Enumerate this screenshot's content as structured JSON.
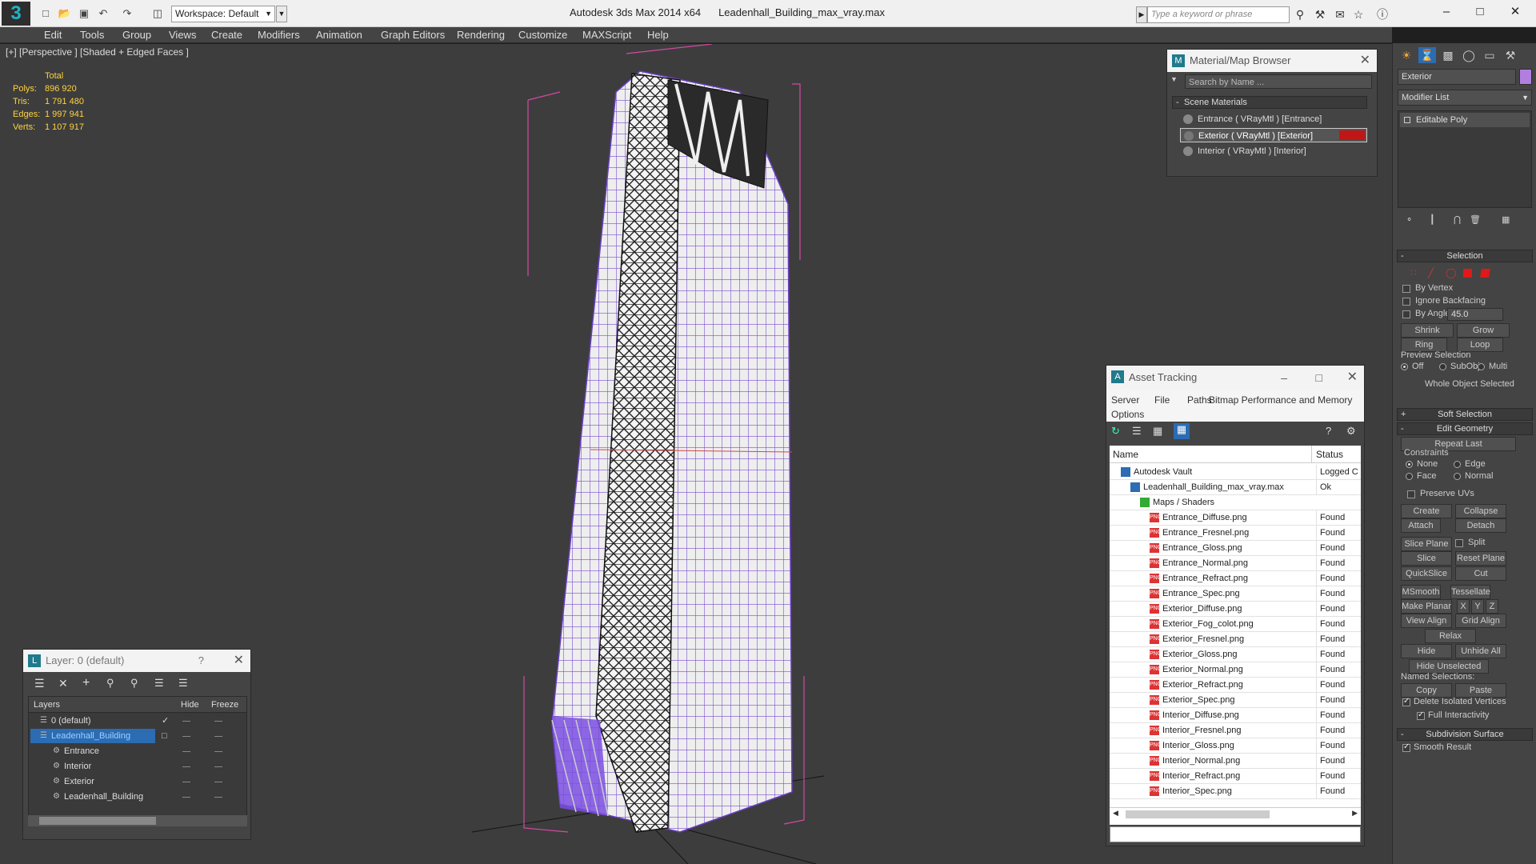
{
  "app": {
    "logo": "3",
    "workspace": "Workspace: Default",
    "title_app": "Autodesk 3ds Max  2014 x64",
    "title_file": "Leadenhall_Building_max_vray.max",
    "search_placeholder": "Type a keyword or phrase"
  },
  "menu": [
    "Edit",
    "Tools",
    "Group",
    "Views",
    "Create",
    "Modifiers",
    "Animation",
    "Graph Editors",
    "Rendering",
    "Customize",
    "MAXScript",
    "Help"
  ],
  "viewport": {
    "label": "[+] [Perspective ] [Shaded + Edged Faces ]",
    "stats": {
      "header": "Total",
      "rows": [
        {
          "k": "Polys:",
          "v": "896 920"
        },
        {
          "k": "Tris:",
          "v": "1 791 480"
        },
        {
          "k": "Edges:",
          "v": "1 997 941"
        },
        {
          "k": "Verts:",
          "v": "1 107 917"
        }
      ]
    }
  },
  "material_browser": {
    "title": "Material/Map Browser",
    "search": "Search by Name ...",
    "group": "Scene Materials",
    "items": [
      "Entrance  ( VRayMtl ) [Entrance]",
      "Exterior  ( VRayMtl ) [Exterior]",
      "Interior  ( VRayMtl ) [Interior]"
    ],
    "swatch_color": "#c01616"
  },
  "asset_tracking": {
    "title": "Asset Tracking",
    "menu": [
      "Server",
      "File",
      "Paths",
      "Bitmap Performance and Memory",
      "Options"
    ],
    "columns": [
      "Name",
      "Status"
    ],
    "rows": [
      {
        "name": "Autodesk Vault",
        "status": "Logged C",
        "indent": 0,
        "icon": "vault-icon"
      },
      {
        "name": "Leadenhall_Building_max_vray.max",
        "status": "Ok",
        "indent": 1,
        "icon": "max-file-icon"
      },
      {
        "name": "Maps / Shaders",
        "status": "",
        "indent": 2,
        "icon": "maps-icon"
      },
      {
        "name": "Entrance_Diffuse.png",
        "status": "Found",
        "indent": 3,
        "icon": "png-icon"
      },
      {
        "name": "Entrance_Fresnel.png",
        "status": "Found",
        "indent": 3,
        "icon": "png-icon"
      },
      {
        "name": "Entrance_Gloss.png",
        "status": "Found",
        "indent": 3,
        "icon": "png-icon"
      },
      {
        "name": "Entrance_Normal.png",
        "status": "Found",
        "indent": 3,
        "icon": "png-icon"
      },
      {
        "name": "Entrance_Refract.png",
        "status": "Found",
        "indent": 3,
        "icon": "png-icon"
      },
      {
        "name": "Entrance_Spec.png",
        "status": "Found",
        "indent": 3,
        "icon": "png-icon"
      },
      {
        "name": "Exterior_Diffuse.png",
        "status": "Found",
        "indent": 3,
        "icon": "png-icon"
      },
      {
        "name": "Exterior_Fog_colot.png",
        "status": "Found",
        "indent": 3,
        "icon": "png-icon"
      },
      {
        "name": "Exterior_Fresnel.png",
        "status": "Found",
        "indent": 3,
        "icon": "png-icon"
      },
      {
        "name": "Exterior_Gloss.png",
        "status": "Found",
        "indent": 3,
        "icon": "png-icon"
      },
      {
        "name": "Exterior_Normal.png",
        "status": "Found",
        "indent": 3,
        "icon": "png-icon"
      },
      {
        "name": "Exterior_Refract.png",
        "status": "Found",
        "indent": 3,
        "icon": "png-icon"
      },
      {
        "name": "Exterior_Spec.png",
        "status": "Found",
        "indent": 3,
        "icon": "png-icon"
      },
      {
        "name": "Interior_Diffuse.png",
        "status": "Found",
        "indent": 3,
        "icon": "png-icon"
      },
      {
        "name": "Interior_Fresnel.png",
        "status": "Found",
        "indent": 3,
        "icon": "png-icon"
      },
      {
        "name": "Interior_Gloss.png",
        "status": "Found",
        "indent": 3,
        "icon": "png-icon"
      },
      {
        "name": "Interior_Normal.png",
        "status": "Found",
        "indent": 3,
        "icon": "png-icon"
      },
      {
        "name": "Interior_Refract.png",
        "status": "Found",
        "indent": 3,
        "icon": "png-icon"
      },
      {
        "name": "Interior_Spec.png",
        "status": "Found",
        "indent": 3,
        "icon": "png-icon"
      }
    ]
  },
  "layers": {
    "title": "Layer: 0 (default)",
    "help": "?",
    "columns": [
      "Layers",
      "Hide",
      "Freeze"
    ],
    "rows": [
      {
        "name": "0 (default)",
        "indent": 0,
        "selected": false,
        "current": true
      },
      {
        "name": "Leadenhall_Building",
        "indent": 0,
        "selected": true,
        "current": false
      },
      {
        "name": "Entrance",
        "indent": 1,
        "selected": false,
        "current": false
      },
      {
        "name": "Interior",
        "indent": 1,
        "selected": false,
        "current": false
      },
      {
        "name": "Exterior",
        "indent": 1,
        "selected": false,
        "current": false
      },
      {
        "name": "Leadenhall_Building",
        "indent": 1,
        "selected": false,
        "current": false
      }
    ]
  },
  "command_panel": {
    "object_name": "Exterior",
    "object_color": "#b27fe0",
    "modifier_list": "Modifier List",
    "stack_item": "Editable Poly",
    "selection": {
      "title": "Selection",
      "by_vertex": "By Vertex",
      "ignore_backfacing": "Ignore Backfacing",
      "by_angle": "By Angle:",
      "angle": "45.0",
      "shrink": "Shrink",
      "grow": "Grow",
      "ring": "Ring",
      "loop": "Loop",
      "preview": "Preview Selection",
      "off": "Off",
      "subobj": "SubObj",
      "multi": "Multi",
      "status": "Whole Object Selected"
    },
    "soft_selection": "Soft Selection",
    "edit_geometry": {
      "title": "Edit Geometry",
      "repeat_last": "Repeat Last",
      "constraints": "Constraints",
      "none": "None",
      "edge": "Edge",
      "face": "Face",
      "normal": "Normal",
      "preserve_uvs": "Preserve UVs",
      "create": "Create",
      "collapse": "Collapse",
      "attach": "Attach",
      "detach": "Detach",
      "slice_plane": "Slice Plane",
      "split": "Split",
      "slice": "Slice",
      "reset_plane": "Reset Plane",
      "quickslice": "QuickSlice",
      "cut": "Cut",
      "msmooth": "MSmooth",
      "tessellate": "Tessellate",
      "make_planar": "Make Planar",
      "x": "X",
      "y": "Y",
      "z": "Z",
      "view_align": "View Align",
      "grid_align": "Grid Align",
      "relax": "Relax",
      "hide_selected": "Hide Selected",
      "unhide_all": "Unhide All",
      "hide_unselected": "Hide Unselected",
      "named_selections": "Named Selections:",
      "copy": "Copy",
      "paste": "Paste",
      "delete_isolated": "Delete Isolated Vertices",
      "full_interactivity": "Full Interactivity"
    },
    "subdivision_surface": "Subdivision Surface",
    "smooth_result": "Smooth Result"
  }
}
